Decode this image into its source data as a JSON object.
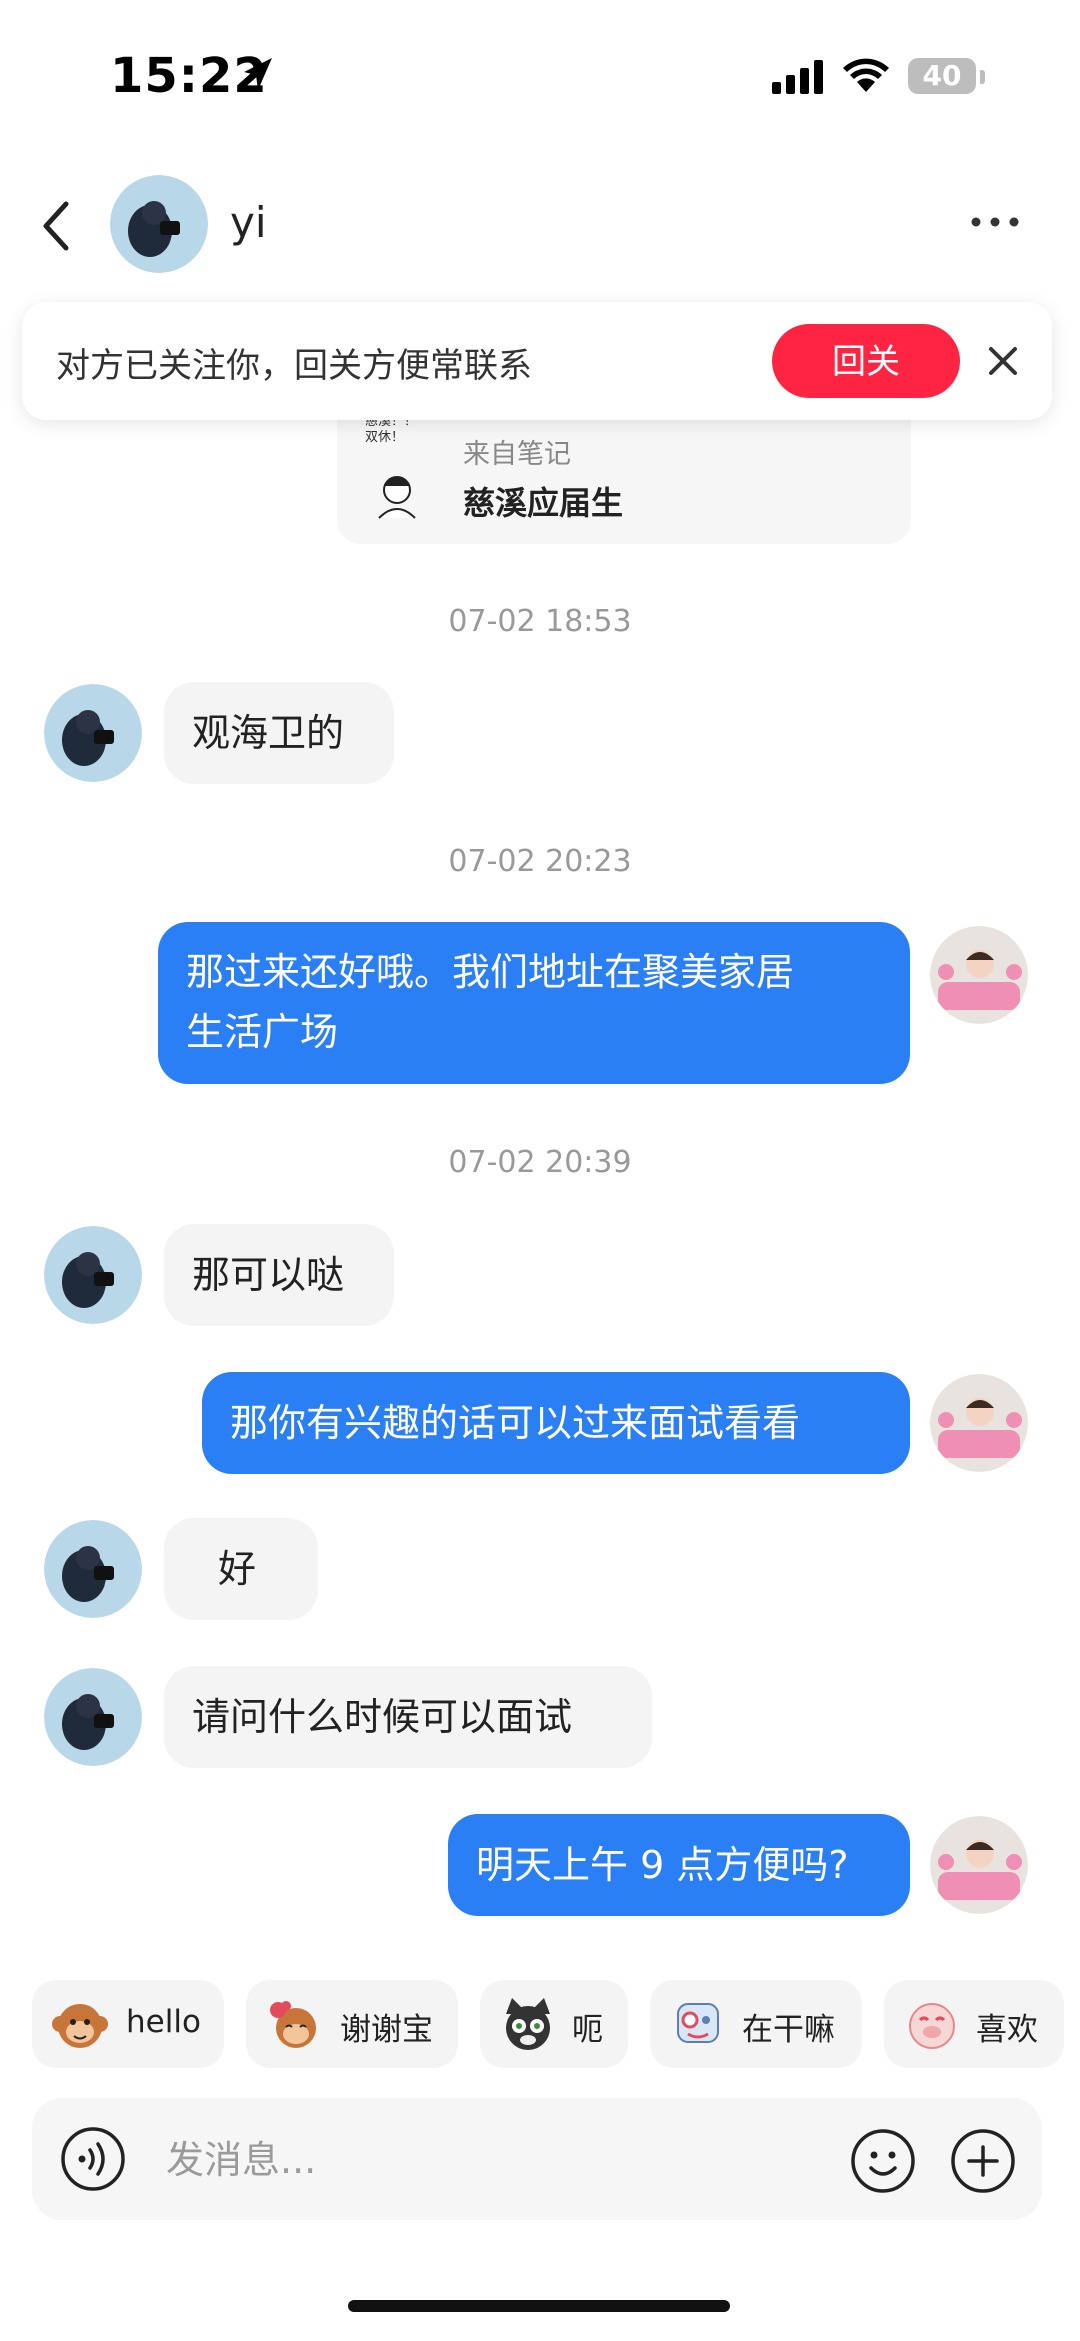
{
  "status_bar": {
    "time": "15:22",
    "battery": "40"
  },
  "header": {
    "contact_name": "yi"
  },
  "banner": {
    "text": "对方已关注你，回关方便常联系",
    "follow_label": "回关"
  },
  "note_card": {
    "thumb_text_1": "慈溪！！",
    "thumb_text_2": "双休！",
    "from_label": "来自笔记",
    "title": "慈溪应届生"
  },
  "messages": {
    "ts1": "07-02 18:53",
    "m1": "观海卫的",
    "ts2": "07-02 20:23",
    "m2_line1": "那过来还好哦。我们地址在聚美家居",
    "m2_line2": "生活广场",
    "ts3": "07-02 20:39",
    "m3": "那可以哒",
    "m4": "那你有兴趣的话可以过来面试看看",
    "m5": "好",
    "m6": "请问什么时候可以面试",
    "m7": "明天上午 9 点方便吗?"
  },
  "quick_stickers": [
    {
      "label": "hello",
      "icon": "monkey-hello-icon"
    },
    {
      "label": "谢谢宝",
      "icon": "monkey-thanks-icon"
    },
    {
      "label": "呃",
      "icon": "cat-speechless-icon"
    },
    {
      "label": "在干嘛",
      "icon": "robot-whatsup-icon"
    },
    {
      "label": "喜欢",
      "icon": "pig-like-icon"
    }
  ],
  "composer": {
    "placeholder": "发消息..."
  },
  "colors": {
    "accent_blue": "#2b7ff5",
    "follow_red": "#ff2442",
    "left_bubble": "#f4f4f4"
  }
}
